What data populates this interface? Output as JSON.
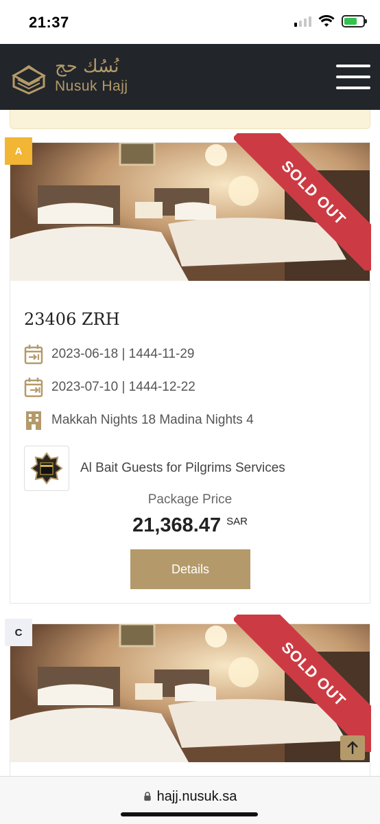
{
  "status_bar": {
    "time": "21:37"
  },
  "header": {
    "logo_arabic": "نُسُك حج",
    "logo_text": "Nusuk Hajj",
    "menu_icon": "hamburger-menu-icon"
  },
  "packages": [
    {
      "badge": "A",
      "ribbon": "SOLD OUT",
      "title": "23406 ZRH",
      "departure": "2023-06-18 | 1444-11-29",
      "return": "2023-07-10 | 1444-12-22",
      "nights": "Makkah Nights 18 Madina Nights 4",
      "provider": "Al Bait Guests for Pilgrims Services",
      "price_label": "Package Price",
      "price": "21,368.47",
      "currency": "SAR",
      "details_label": "Details"
    },
    {
      "badge": "C",
      "ribbon": "SOLD OUT"
    }
  ],
  "browser": {
    "url": "hajj.nusuk.sa"
  },
  "colors": {
    "brand_gold": "#b49a6a",
    "header_dark": "#22262a",
    "ribbon_red": "#cc3b43",
    "badge_yellow": "#f2b534"
  }
}
